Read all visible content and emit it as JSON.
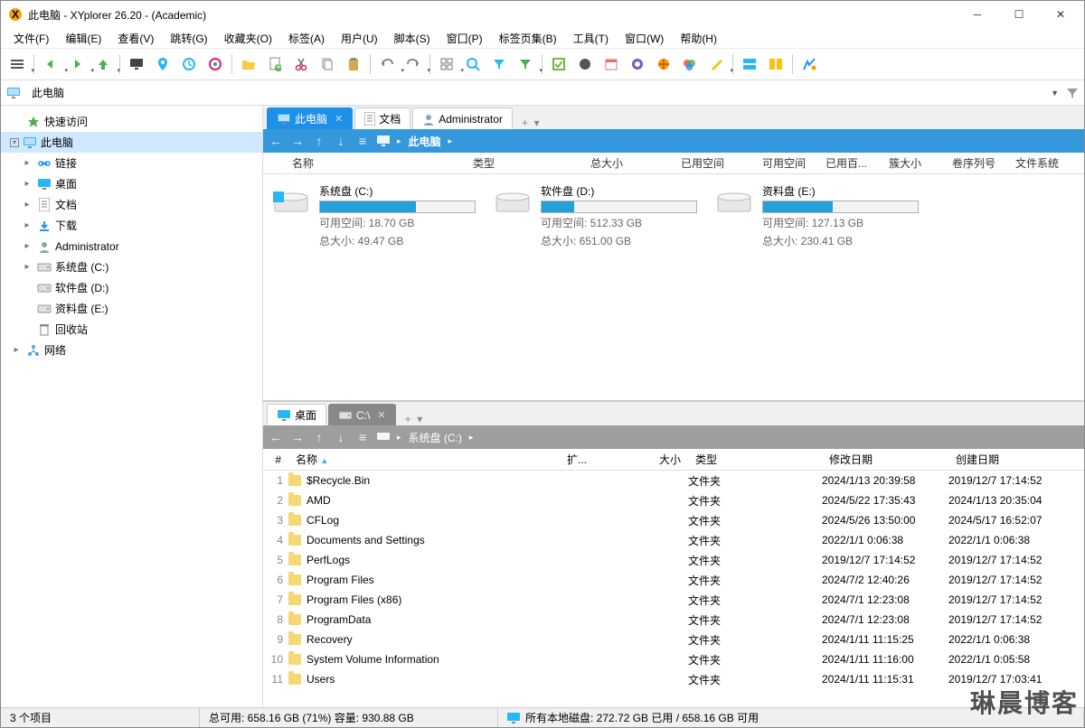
{
  "title": "此电脑 - XYplorer 26.20 - (Academic)",
  "menu": [
    "文件(F)",
    "编辑(E)",
    "查看(V)",
    "跳转(G)",
    "收藏夹(O)",
    "标签(A)",
    "用户(U)",
    "脚本(S)",
    "窗囗(P)",
    "标签页集(B)",
    "工具(T)",
    "窗口(W)",
    "帮助(H)"
  ],
  "address": "此电脑",
  "sidebar": [
    {
      "label": "快速访问",
      "icon": "star",
      "level": 0,
      "tw": ""
    },
    {
      "label": "此电脑",
      "icon": "pc",
      "level": 0,
      "tw": "▾",
      "selected": true,
      "box": true
    },
    {
      "label": "链接",
      "icon": "link",
      "level": 1,
      "tw": "▸"
    },
    {
      "label": "桌面",
      "icon": "desktop",
      "level": 1,
      "tw": "▸"
    },
    {
      "label": "文档",
      "icon": "doc",
      "level": 1,
      "tw": "▸"
    },
    {
      "label": "下载",
      "icon": "download",
      "level": 1,
      "tw": "▸"
    },
    {
      "label": "Administrator",
      "icon": "user",
      "level": 1,
      "tw": "▸"
    },
    {
      "label": "系统盘 (C:)",
      "icon": "drive",
      "level": 1,
      "tw": "▸"
    },
    {
      "label": "软件盘 (D:)",
      "icon": "drive",
      "level": 1,
      "tw": ""
    },
    {
      "label": "资料盘 (E:)",
      "icon": "drive",
      "level": 1,
      "tw": ""
    },
    {
      "label": "回收站",
      "icon": "recycle",
      "level": 1,
      "tw": ""
    },
    {
      "label": "网络",
      "icon": "network",
      "level": 0,
      "tw": "▸"
    }
  ],
  "top_pane": {
    "tabs": [
      {
        "label": "此电脑",
        "icon": "pc",
        "active": true
      },
      {
        "label": "文档",
        "icon": "doc"
      },
      {
        "label": "Administrator",
        "icon": "user"
      }
    ],
    "crumb": "此电脑",
    "columns": [
      "名称",
      "类型",
      "总大小",
      "已用空间",
      "可用空间",
      "已用百...",
      "簇大小",
      "卷序列号",
      "文件系统"
    ],
    "drives": [
      {
        "name": "系统盘 (C:)",
        "free": "可用空间: 18.70 GB",
        "total": "总大小: 49.47 GB",
        "pct": 62
      },
      {
        "name": "软件盘 (D:)",
        "free": "可用空间: 512.33 GB",
        "total": "总大小: 651.00 GB",
        "pct": 21
      },
      {
        "name": "资料盘 (E:)",
        "free": "可用空间: 127.13 GB",
        "total": "总大小: 230.41 GB",
        "pct": 45
      }
    ]
  },
  "bottom_pane": {
    "tabs": [
      {
        "label": "桌面",
        "icon": "desktop"
      },
      {
        "label": "C:\\",
        "icon": "drive",
        "active": true
      }
    ],
    "crumb": "系统盘 (C:)",
    "columns": {
      "num": "#",
      "name": "名称",
      "ext": "扩...",
      "size": "大小",
      "type": "类型",
      "mdate": "修改日期",
      "cdate": "创建日期"
    },
    "rows": [
      {
        "n": "1",
        "name": "$Recycle.Bin",
        "type": "文件夹",
        "m": "2024/1/13 20:39:58",
        "c": "2019/12/7 17:14:52"
      },
      {
        "n": "2",
        "name": "AMD",
        "type": "文件夹",
        "m": "2024/5/22 17:35:43",
        "c": "2024/1/13 20:35:04"
      },
      {
        "n": "3",
        "name": "CFLog",
        "type": "文件夹",
        "m": "2024/5/26 13:50:00",
        "c": "2024/5/17 16:52:07"
      },
      {
        "n": "4",
        "name": "Documents and Settings",
        "type": "文件夹",
        "m": "2022/1/1 0:06:38",
        "c": "2022/1/1 0:06:38"
      },
      {
        "n": "5",
        "name": "PerfLogs",
        "type": "文件夹",
        "m": "2019/12/7 17:14:52",
        "c": "2019/12/7 17:14:52"
      },
      {
        "n": "6",
        "name": "Program Files",
        "type": "文件夹",
        "m": "2024/7/2 12:40:26",
        "c": "2019/12/7 17:14:52"
      },
      {
        "n": "7",
        "name": "Program Files (x86)",
        "type": "文件夹",
        "m": "2024/7/1 12:23:08",
        "c": "2019/12/7 17:14:52"
      },
      {
        "n": "8",
        "name": "ProgramData",
        "type": "文件夹",
        "m": "2024/7/1 12:23:08",
        "c": "2019/12/7 17:14:52"
      },
      {
        "n": "9",
        "name": "Recovery",
        "type": "文件夹",
        "m": "2024/1/11 11:15:25",
        "c": "2022/1/1 0:06:38"
      },
      {
        "n": "10",
        "name": "System Volume Information",
        "type": "文件夹",
        "m": "2024/1/11 11:16:00",
        "c": "2022/1/1 0:05:58"
      },
      {
        "n": "11",
        "name": "Users",
        "type": "文件夹",
        "m": "2024/1/11 11:15:31",
        "c": "2019/12/7 17:03:41"
      }
    ]
  },
  "status": {
    "items": "3 个项目",
    "free": "总可用: 658.16 GB (71%)   容量: 930.88 GB",
    "disks": "所有本地磁盘: 272.72 GB 已用 / 658.16 GB 可用"
  },
  "watermark": "琳晨博客"
}
